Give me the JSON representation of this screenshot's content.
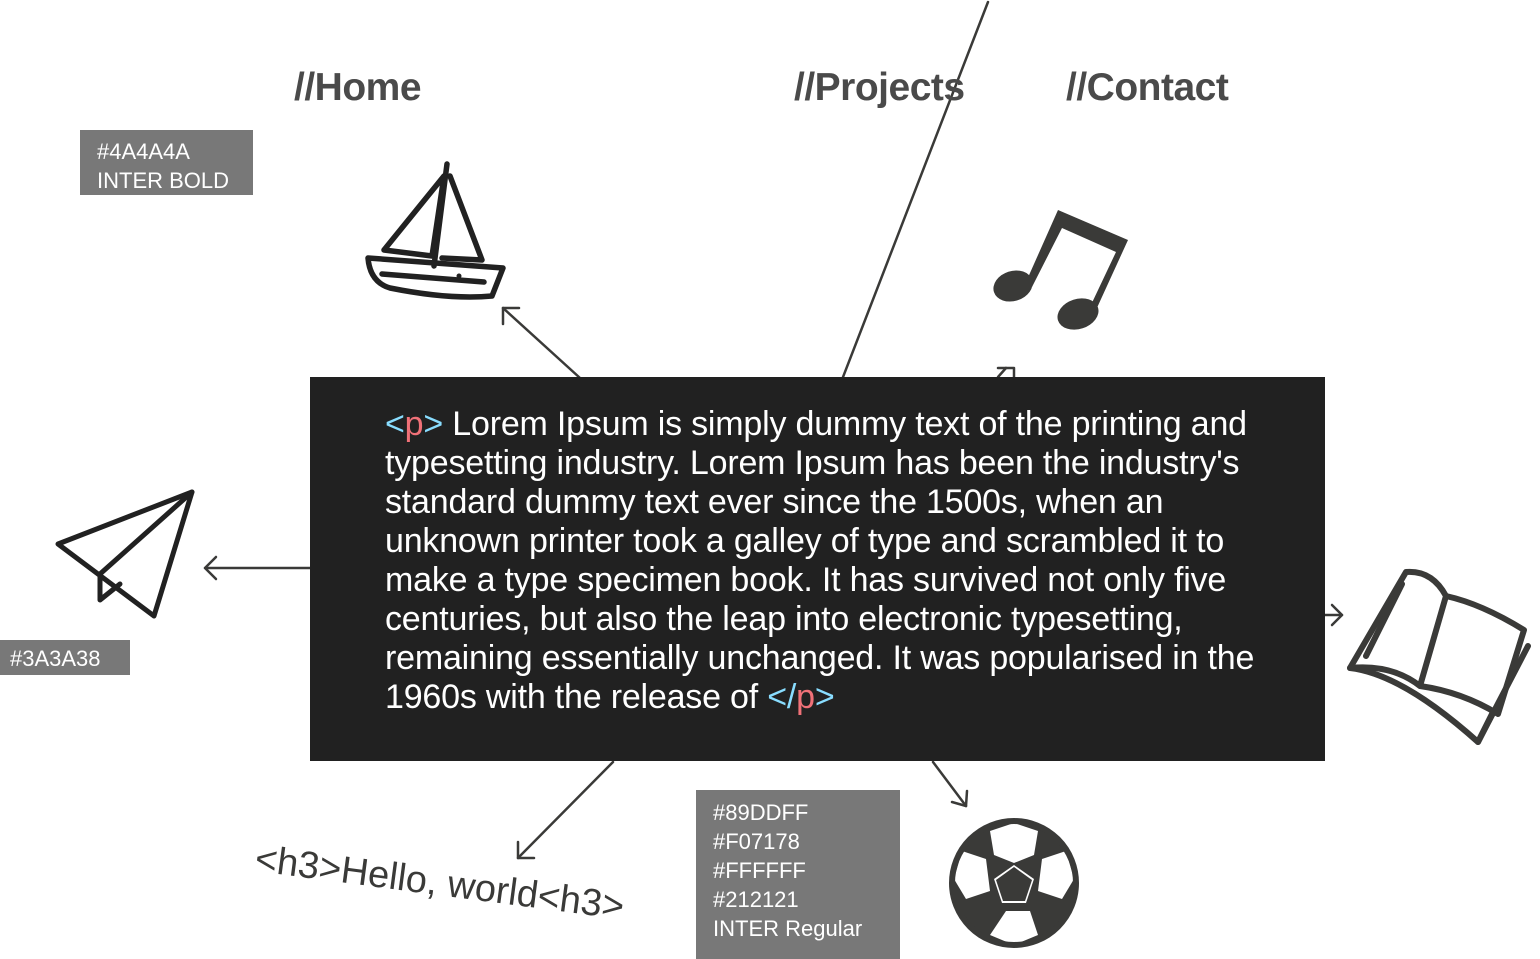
{
  "nav": {
    "home": "//Home",
    "projects": "//Projects",
    "contact": "//Contact"
  },
  "swatches": {
    "heading": [
      "#4A4A4A",
      "INTER BOLD"
    ],
    "icons": [
      "#3A3A38"
    ],
    "code": [
      "#89DDFF",
      "#F07178",
      "#FFFFFF",
      "#212121",
      "INTER Regular"
    ]
  },
  "code_block": {
    "open_bracket": "<",
    "open_tag": "p",
    "open_close_bracket": ">",
    "body": " Lorem Ipsum is simply dummy text of the printing and typesetting industry. Lorem Ipsum has been the industry's standard dummy text ever since the 1500s, when an unknown printer took a galley of type and scrambled it to make a type specimen book. It has survived not only five centuries, but also the leap into electronic typesetting, remaining essentially unchanged. It was popularised in the 1960s with the release of ",
    "close_bracket": "</",
    "close_tag": "p",
    "close_end_bracket": ">"
  },
  "hello_text": "<h3>Hello, world<h3>",
  "icons": [
    "sailboat-icon",
    "music-note-icon",
    "paper-plane-icon",
    "open-book-icon",
    "soccer-ball-icon"
  ],
  "colors": {
    "heading": "#4A4A4A",
    "icon": "#3A3A38",
    "bracket": "#89DDFF",
    "tag": "#F07178",
    "text": "#FFFFFF",
    "background": "#212121",
    "swatch_bg": "#787878"
  }
}
